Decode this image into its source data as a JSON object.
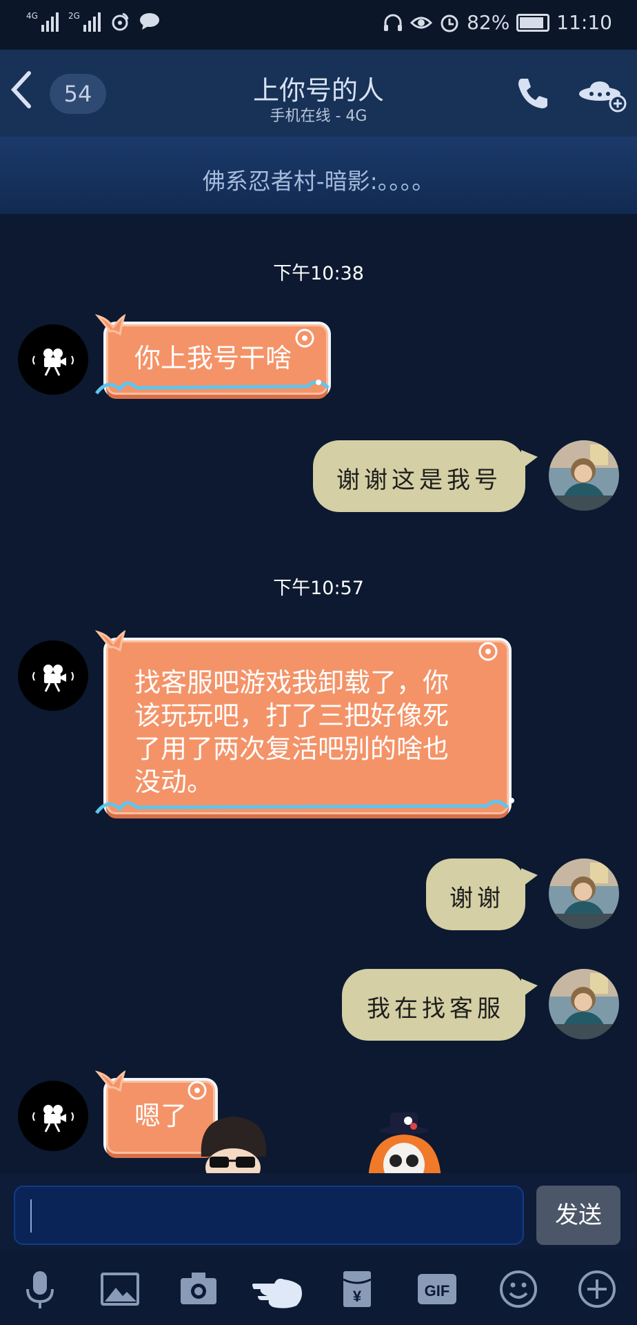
{
  "status_bar": {
    "left_labels": [
      "4G",
      "2G"
    ],
    "battery": "82%",
    "time": "11:10"
  },
  "header": {
    "back_icon": "chevron-left-icon",
    "unread_count": "54",
    "title": "上你号的人",
    "subtitle": "手机在线 - 4G",
    "call_icon": "phone-icon",
    "more_icon": "ufo-plus-icon"
  },
  "banner": {
    "text": "佛系忍者村-暗影:。。。。"
  },
  "messages": [
    {
      "type": "time",
      "text": "下午10:38"
    },
    {
      "side": "left",
      "text": "你上我号干啥"
    },
    {
      "side": "right",
      "text": "谢谢这是我号"
    },
    {
      "type": "time",
      "text": "下午10:57"
    },
    {
      "side": "left",
      "lines": [
        "找客服吧游戏我卸载了，你",
        "该玩玩吧，打了三把好像死",
        "了用了两次复活吧别的啥也",
        "没动。"
      ]
    },
    {
      "side": "right",
      "text": "谢谢"
    },
    {
      "side": "right",
      "text": "我在找客服"
    },
    {
      "side": "left",
      "text": "嗯了"
    }
  ],
  "input": {
    "placeholder": "",
    "send_label": "发送"
  },
  "toolbar": {
    "items": [
      "microphone-icon",
      "image-icon",
      "camera-icon",
      "poke-hand-icon",
      "red-packet-icon",
      "gif-icon",
      "emoji-icon",
      "add-icon"
    ],
    "gif_label": "GIF",
    "packet_symbol": "¥"
  },
  "colors": {
    "background": "#0c1930",
    "header": "#183157",
    "orange_bubble": "#f49368",
    "beige_bubble": "#d4cfa4",
    "send_button": "#4b5668"
  }
}
